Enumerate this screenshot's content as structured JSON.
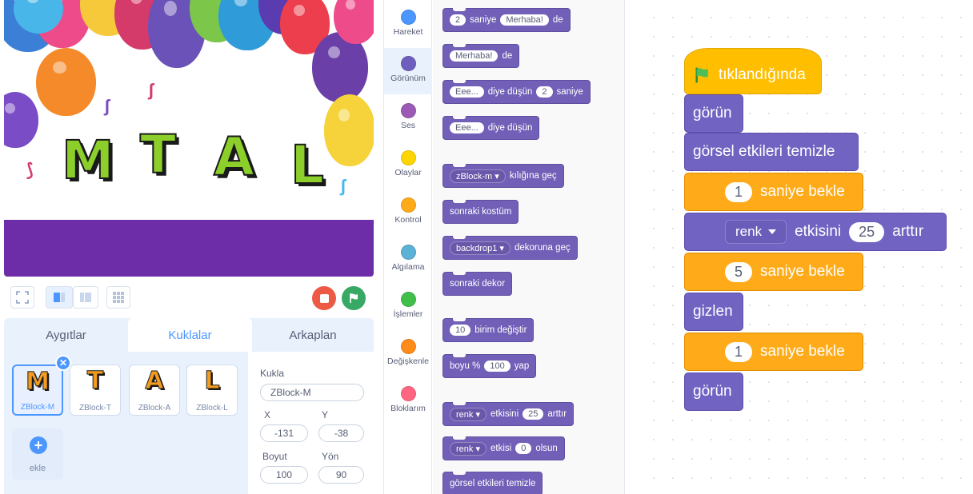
{
  "stage": {
    "letters": [
      "M",
      "T",
      "A",
      "L"
    ]
  },
  "sprite_pane": {
    "tabs": [
      "Aygıtlar",
      "Kuklalar",
      "Arkaplan"
    ],
    "active_tab": "Kuklalar",
    "sprites": [
      {
        "glyph": "M",
        "name": "ZBlock-M",
        "selected": true
      },
      {
        "glyph": "T",
        "name": "ZBlock-T",
        "selected": false
      },
      {
        "glyph": "A",
        "name": "ZBlock-A",
        "selected": false
      },
      {
        "glyph": "L",
        "name": "ZBlock-L",
        "selected": false
      }
    ],
    "add_label": "ekle",
    "info": {
      "sprite_label": "Kukla",
      "sprite_value": "ZBlock-M",
      "x_label": "X",
      "x_value": "-131",
      "y_label": "Y",
      "y_value": "-38",
      "size_label": "Boyut",
      "size_value": "100",
      "direction_label": "Yön",
      "direction_value": "90"
    }
  },
  "categories": [
    {
      "label": "Hareket",
      "color": "#4c97ff"
    },
    {
      "label": "Görünüm",
      "color": "#6e5fbf",
      "active": true
    },
    {
      "label": "Ses",
      "color": "#9b5bb5"
    },
    {
      "label": "Olaylar",
      "color": "#ffd500"
    },
    {
      "label": "Kontrol",
      "color": "#ffab19"
    },
    {
      "label": "Algılama",
      "color": "#5cb1d6"
    },
    {
      "label": "İşlemler",
      "color": "#40bf4a"
    },
    {
      "label": "Değişkenle",
      "color": "#ff8c1a"
    },
    {
      "label": "Bloklarım",
      "color": "#ff6680"
    }
  ],
  "palette": {
    "b1": {
      "num": "2",
      "w1": "saniye",
      "msg": "Merhaba!",
      "w2": "de"
    },
    "b2": {
      "msg": "Merhaba!",
      "w1": "de"
    },
    "b3": {
      "msg": "Eee...",
      "w1": "diye düşün",
      "num": "2",
      "w2": "saniye"
    },
    "b4": {
      "msg": "Eee...",
      "w1": "diye düşün"
    },
    "b5": {
      "drop": "zBlock-m ▾",
      "w1": "kılığına geç"
    },
    "b6": {
      "text": "sonraki kostüm"
    },
    "b7": {
      "drop": "backdrop1 ▾",
      "w1": "dekoruna geç"
    },
    "b8": {
      "text": "sonraki dekor"
    },
    "b9": {
      "num": "10",
      "w1": "birim değiştir"
    },
    "b10": {
      "w1": "boyu %",
      "num": "100",
      "w2": "yap"
    },
    "b11": {
      "drop": "renk ▾",
      "w1": "etkisini",
      "num": "25",
      "w2": "arttır"
    },
    "b12": {
      "drop": "renk ▾",
      "w1": "etkisi",
      "num": "0",
      "w2": "olsun"
    },
    "b13": {
      "text": "görsel etkileri temizle"
    }
  },
  "script": {
    "hat": "tıklandığında",
    "b1": "görün",
    "b2": "görsel etkileri temizle",
    "b3": {
      "num": "1",
      "text": "saniye bekle"
    },
    "b4": {
      "drop": "renk",
      "w1": "etkisini",
      "num": "25",
      "w2": "arttır"
    },
    "b5": {
      "num": "5",
      "text": "saniye bekle"
    },
    "b6": "gizlen",
    "b7": {
      "num": "1",
      "text": "saniye bekle"
    },
    "b8": "görün"
  },
  "colors": {
    "looks": "#7163c2",
    "control": "#ffab19",
    "events": "#ffbf00",
    "stop": "#ec5a45",
    "go": "#38a865"
  }
}
